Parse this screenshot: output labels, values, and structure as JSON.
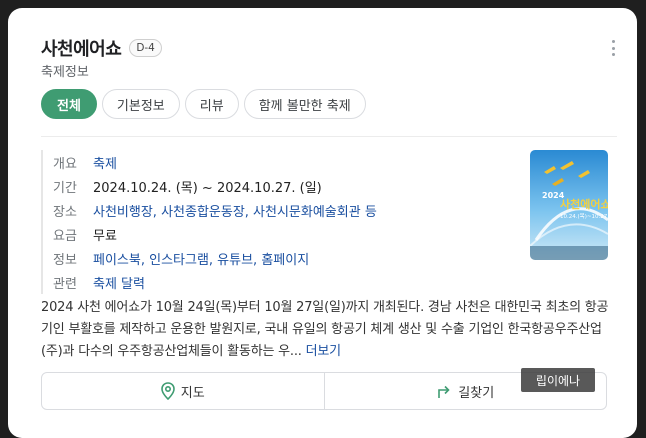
{
  "header": {
    "title": "사천에어쇼",
    "dday": "D-4",
    "subtitle": "축제정보"
  },
  "tabs": [
    {
      "label": "전체",
      "active": true
    },
    {
      "label": "기본정보",
      "active": false
    },
    {
      "label": "리뷰",
      "active": false
    },
    {
      "label": "함께 볼만한 축제",
      "active": false
    }
  ],
  "info": {
    "overview": {
      "label": "개요",
      "value": "축제"
    },
    "period": {
      "label": "기간",
      "value": "2024.10.24. (목) ~  2024.10.27. (일)"
    },
    "place": {
      "label": "장소",
      "value": "사천비행장, 사천종합운동장, 사천시문화예술회관 등"
    },
    "fee": {
      "label": "요금",
      "value": "무료"
    },
    "links": {
      "label": "정보",
      "value": "페이스북, 인스타그램, 유튜브, 홈페이지"
    },
    "related": {
      "label": "관련",
      "value": "축제 달력"
    }
  },
  "poster": {
    "year": "2024",
    "title": "사천에어쇼",
    "dates": "10.24.(목)~10.27.(일)"
  },
  "description": {
    "text": "2024 사천 에어쇼가 10월 24일(목)부터 10월 27일(일)까지 개최된다. 경남 사천은 대한민국 최초의 항공기인 부활호를 제작하고 운용한 발원지로, 국내 유일의 항공기 체계 생산 및 수출 기업인 한국항공우주산업(주)과 다수의 우주항공산업체들이 활동하는 우...",
    "more_label": "더보기"
  },
  "actions": {
    "map_label": "지도",
    "directions_label": "길찾기"
  },
  "watermark": "립이에나",
  "colors": {
    "accent": "#3f9c72",
    "link": "#1a4fa0"
  }
}
